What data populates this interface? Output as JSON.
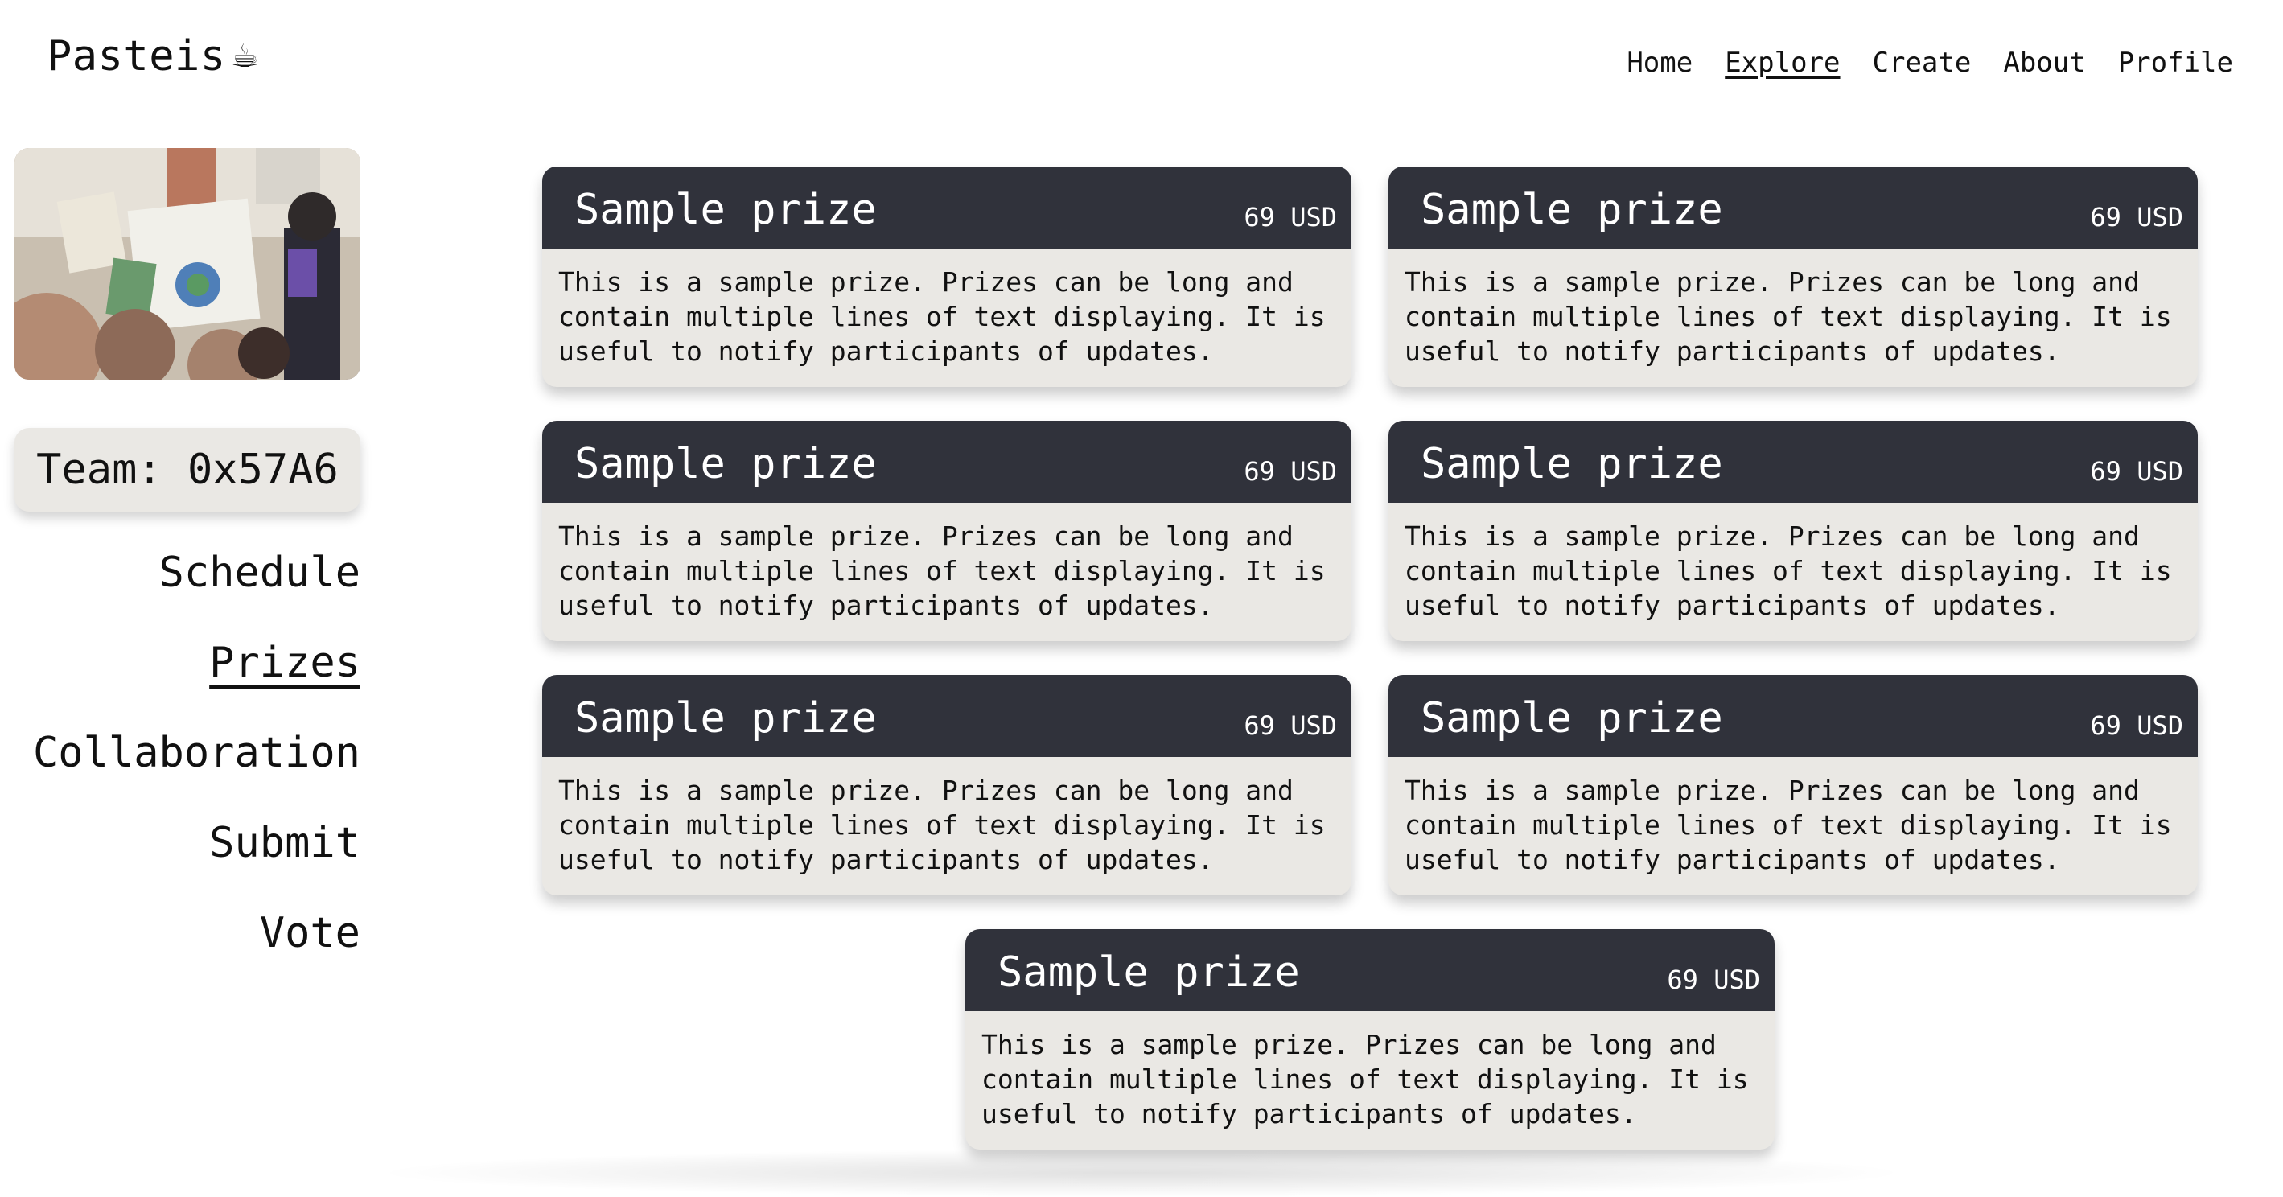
{
  "brand": {
    "name": "Pasteis",
    "icon": "coffee-cup-icon"
  },
  "topnav": [
    {
      "label": "Home",
      "active": false
    },
    {
      "label": "Explore",
      "active": true
    },
    {
      "label": "Create",
      "active": false
    },
    {
      "label": "About",
      "active": false
    },
    {
      "label": "Profile",
      "active": false
    }
  ],
  "sidebar": {
    "team_label": "Team: 0x57A6",
    "items": [
      {
        "label": "Schedule",
        "active": false
      },
      {
        "label": "Prizes",
        "active": true
      },
      {
        "label": "Collaboration",
        "active": false
      },
      {
        "label": "Submit",
        "active": false
      },
      {
        "label": "Vote",
        "active": false
      }
    ]
  },
  "prizes": [
    {
      "title": "Sample prize",
      "amount": "69 USD",
      "description": "This is a sample prize. Prizes can be long and contain multiple lines of text displaying. It is useful to notify participants of updates."
    },
    {
      "title": "Sample prize",
      "amount": "69 USD",
      "description": "This is a sample prize. Prizes can be long and contain multiple lines of text displaying. It is useful to notify participants of updates."
    },
    {
      "title": "Sample prize",
      "amount": "69 USD",
      "description": "This is a sample prize. Prizes can be long and contain multiple lines of text displaying. It is useful to notify participants of updates."
    },
    {
      "title": "Sample prize",
      "amount": "69 USD",
      "description": "This is a sample prize. Prizes can be long and contain multiple lines of text displaying. It is useful to notify participants of updates."
    },
    {
      "title": "Sample prize",
      "amount": "69 USD",
      "description": "This is a sample prize. Prizes can be long and contain multiple lines of text displaying. It is useful to notify participants of updates."
    },
    {
      "title": "Sample prize",
      "amount": "69 USD",
      "description": "This is a sample prize. Prizes can be long and contain multiple lines of text displaying. It is useful to notify participants of updates."
    },
    {
      "title": "Sample prize",
      "amount": "69 USD",
      "description": "This is a sample prize. Prizes can be long and contain multiple lines of text displaying. It is useful to notify participants of updates."
    }
  ],
  "colors": {
    "card_header": "#30323b",
    "card_body": "#eae8e4",
    "text": "#111111"
  }
}
